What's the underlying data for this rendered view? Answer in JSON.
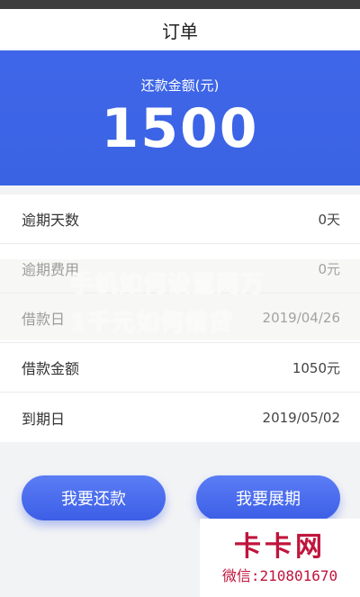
{
  "header": {
    "title": "订单"
  },
  "summary": {
    "label": "还款金额(元)",
    "amount": "1500"
  },
  "details": [
    {
      "label": "逾期天数",
      "value": "0天"
    },
    {
      "label": "逾期费用",
      "value": "0元"
    },
    {
      "label": "借款日",
      "value": "2019/04/26"
    },
    {
      "label": "借款金额",
      "value": "1050元"
    },
    {
      "label": "到期日",
      "value": "2019/05/02"
    }
  ],
  "actions": {
    "repay_label": "我要还款",
    "extend_label": "我要展期"
  },
  "watermark": {
    "line1": "手机如何设置两万",
    "line2": "1千元如何借贷",
    "corner_brand": "卡卡网",
    "corner_contact": "微信:210801670"
  },
  "colors": {
    "primary": "#3d63e6",
    "brand_red": "#c0143c",
    "background": "#f2f3f5"
  }
}
